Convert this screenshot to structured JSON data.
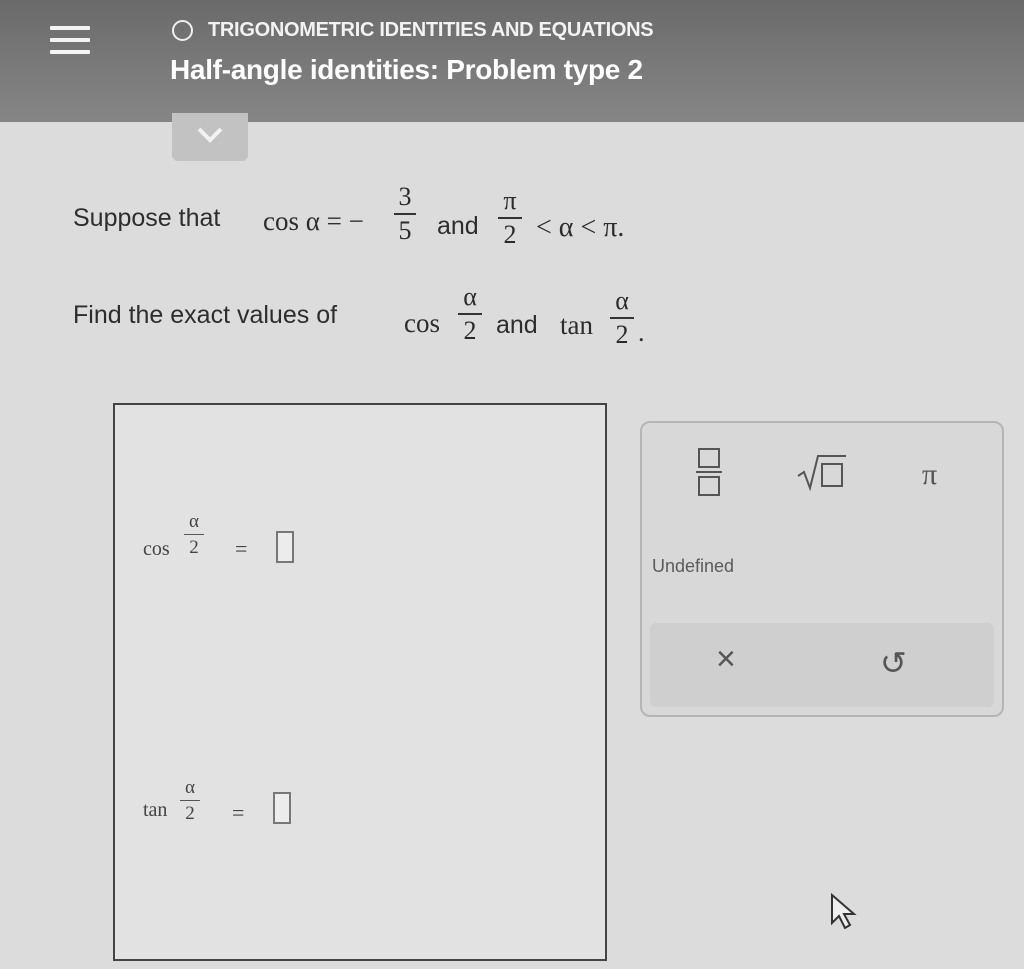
{
  "header": {
    "topic": "TRIGONOMETRIC IDENTITIES AND EQUATIONS",
    "title": "Half-angle identities: Problem type 2"
  },
  "problem": {
    "intro": "Suppose that",
    "cos_alpha_lhs": "cos α = −",
    "frac1_num": "3",
    "frac1_den": "5",
    "and1": "and",
    "frac2_num": "π",
    "frac2_den": "2",
    "ineq": "< α < π.",
    "find_text": "Find the exact values of",
    "cos_label": "cos",
    "half_num": "α",
    "half_den": "2",
    "and2": "and",
    "tan_label": "tan",
    "period": "."
  },
  "answers": {
    "cos_label": "cos",
    "tan_label": "tan",
    "frac_num": "α",
    "frac_den": "2",
    "equals": "="
  },
  "palette": {
    "pi_symbol": "π",
    "undefined_label": "Undefined",
    "clear_symbol": "×",
    "undo_symbol": "↺"
  }
}
